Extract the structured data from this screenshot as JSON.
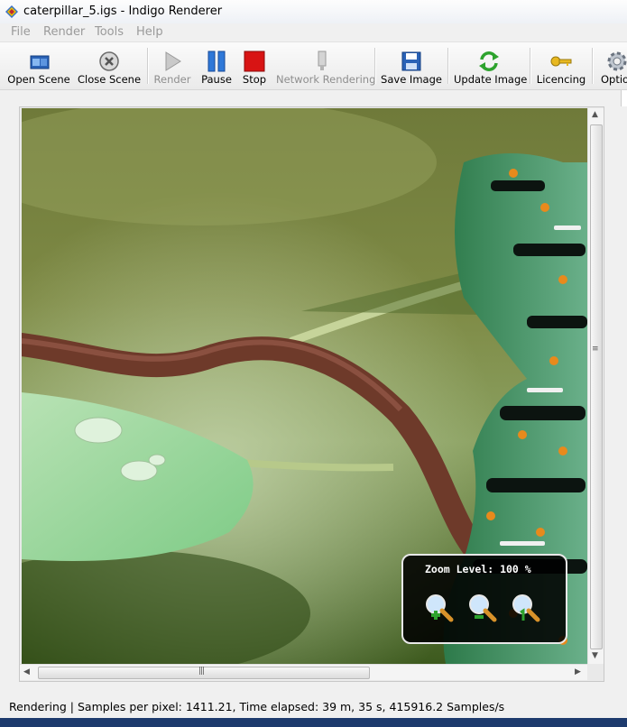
{
  "window": {
    "title": "caterpillar_5.igs - Indigo Renderer"
  },
  "menu": [
    "File",
    "Render",
    "Tools",
    "Help"
  ],
  "toolbar": {
    "open_scene": "Open Scene",
    "close_scene": "Close Scene",
    "render": "Render",
    "pause": "Pause",
    "stop": "Stop",
    "network_rendering": "Network Rendering",
    "save_image": "Save Image",
    "update_image": "Update Image",
    "licencing": "Licencing",
    "options": "Options"
  },
  "zoom": {
    "label": "Zoom Level: 100 %"
  },
  "status": {
    "text": "Rendering | Samples per pixel: 1411.21, Time elapsed: 39 m, 35 s, 415916.2 Samples/s"
  },
  "icons": {
    "app": "indigo-logo-icon",
    "open": "folder-open-icon",
    "close": "close-circle-icon",
    "render": "play-icon",
    "pause": "pause-icon",
    "stop": "stop-icon",
    "network": "network-icon",
    "save": "floppy-disk-icon",
    "update": "refresh-icon",
    "licence": "key-icon",
    "options": "gear-icon",
    "zoom_in": "zoom-in-icon",
    "zoom_out": "zoom-out-icon",
    "zoom_actual": "zoom-actual-size-icon"
  },
  "colors": {
    "stop_red": "#d81414",
    "pause_blue": "#2f78d8",
    "update_green": "#2ea32e",
    "key_gold": "#e8b820"
  }
}
